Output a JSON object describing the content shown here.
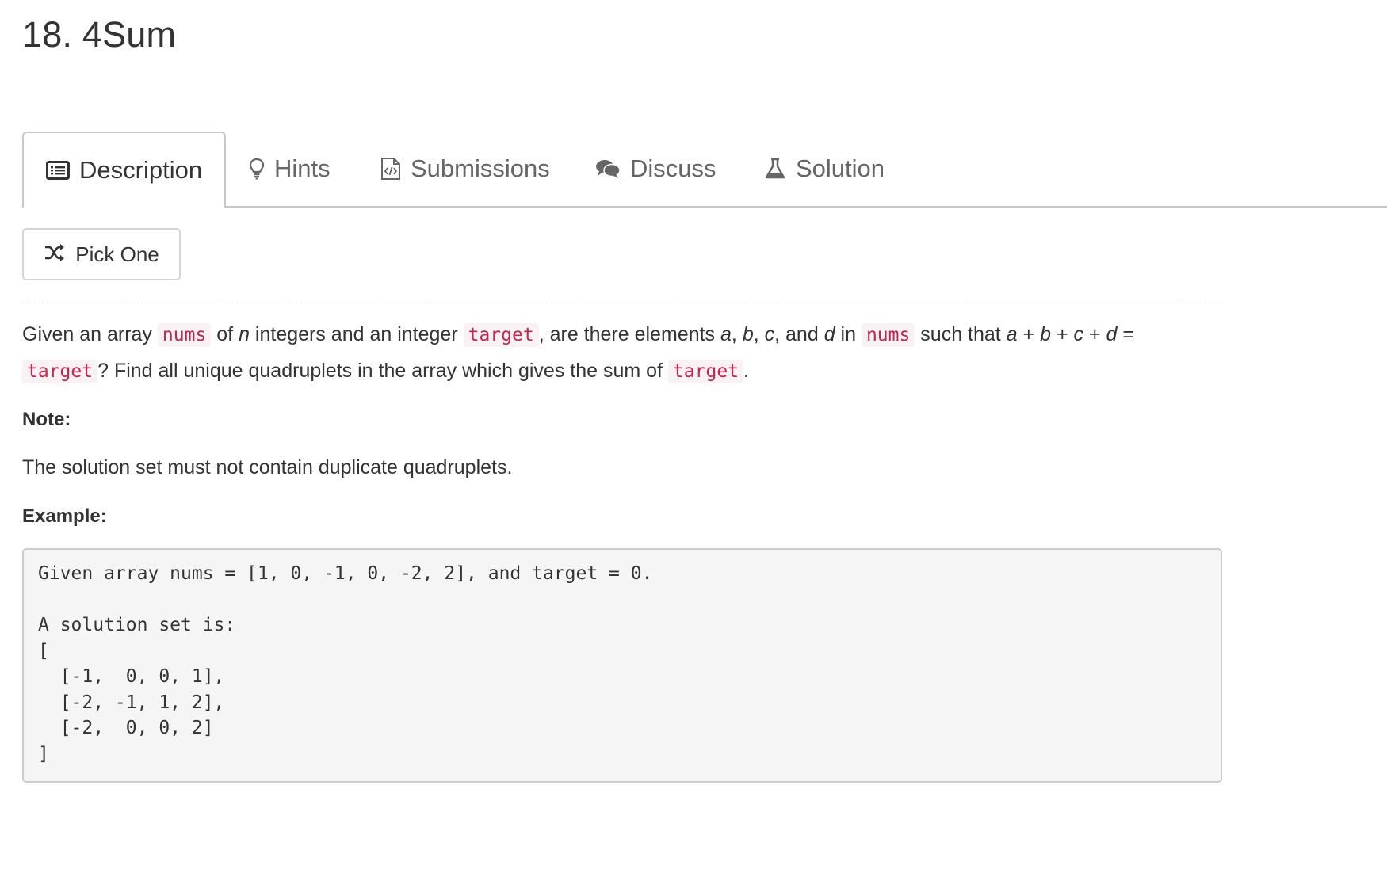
{
  "problem": {
    "title": "18. 4Sum"
  },
  "tabs": [
    {
      "label": "Description",
      "icon": "description-icon",
      "active": true
    },
    {
      "label": "Hints",
      "icon": "lightbulb-icon",
      "active": false
    },
    {
      "label": "Submissions",
      "icon": "code-file-icon",
      "active": false
    },
    {
      "label": "Discuss",
      "icon": "chat-bubbles-icon",
      "active": false
    },
    {
      "label": "Solution",
      "icon": "flask-icon",
      "active": false
    }
  ],
  "pick_one": {
    "label": "Pick One",
    "icon": "shuffle-icon"
  },
  "description": {
    "p1": [
      "Given an array ",
      " of ",
      " integers and an integer ",
      ", are there elements ",
      ", ",
      ", ",
      ", and ",
      " in ",
      " such that ",
      " + ",
      " + ",
      " + ",
      " =",
      "? Find all unique quadruplets in the array which gives the sum of ",
      "."
    ],
    "code": {
      "nums": "nums",
      "target": "target"
    },
    "vars": {
      "n": "n",
      "a": "a",
      "b": "b",
      "c": "c",
      "d": "d"
    }
  },
  "note": {
    "heading": "Note:",
    "text": "The solution set must not contain duplicate quadruplets."
  },
  "example": {
    "heading": "Example:",
    "code": "Given array nums = [1, 0, -1, 0, -2, 2], and target = 0.\n\nA solution set is:\n[\n  [-1,  0, 0, 1],\n  [-2, -1, 1, 2],\n  [-2,  0, 0, 2]\n]"
  },
  "colors": {
    "code_text": "#c7254e",
    "code_bg": "#f9f2f4",
    "tab_border": "#c8c8c8"
  }
}
